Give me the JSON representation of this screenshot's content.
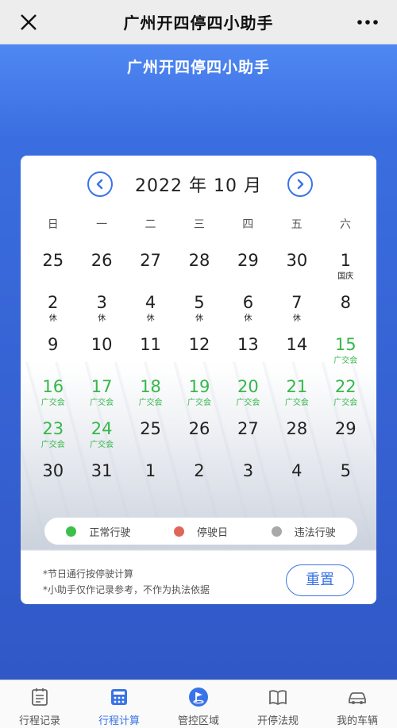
{
  "topbar": {
    "title": "广州开四停四小助手"
  },
  "banner": {
    "title": "广州开四停四小助手"
  },
  "calendar": {
    "month_title": "2022 年 10 月",
    "weekdays": [
      "日",
      "一",
      "二",
      "三",
      "四",
      "五",
      "六"
    ],
    "days": [
      {
        "n": "25",
        "note": ""
      },
      {
        "n": "26",
        "note": ""
      },
      {
        "n": "27",
        "note": ""
      },
      {
        "n": "28",
        "note": ""
      },
      {
        "n": "29",
        "note": ""
      },
      {
        "n": "30",
        "note": ""
      },
      {
        "n": "1",
        "note": "国庆"
      },
      {
        "n": "2",
        "note": "休"
      },
      {
        "n": "3",
        "note": "休"
      },
      {
        "n": "4",
        "note": "休"
      },
      {
        "n": "5",
        "note": "休"
      },
      {
        "n": "6",
        "note": "休"
      },
      {
        "n": "7",
        "note": "休"
      },
      {
        "n": "8",
        "note": ""
      },
      {
        "n": "9",
        "note": ""
      },
      {
        "n": "10",
        "note": ""
      },
      {
        "n": "11",
        "note": ""
      },
      {
        "n": "12",
        "note": ""
      },
      {
        "n": "13",
        "note": ""
      },
      {
        "n": "14",
        "note": ""
      },
      {
        "n": "15",
        "note": "广交会",
        "green": true
      },
      {
        "n": "16",
        "note": "广交会",
        "green": true
      },
      {
        "n": "17",
        "note": "广交会",
        "green": true
      },
      {
        "n": "18",
        "note": "广交会",
        "green": true
      },
      {
        "n": "19",
        "note": "广交会",
        "green": true
      },
      {
        "n": "20",
        "note": "广交会",
        "green": true
      },
      {
        "n": "21",
        "note": "广交会",
        "green": true
      },
      {
        "n": "22",
        "note": "广交会",
        "green": true
      },
      {
        "n": "23",
        "note": "广交会",
        "green": true
      },
      {
        "n": "24",
        "note": "广交会",
        "green": true
      },
      {
        "n": "25",
        "note": ""
      },
      {
        "n": "26",
        "note": ""
      },
      {
        "n": "27",
        "note": ""
      },
      {
        "n": "28",
        "note": ""
      },
      {
        "n": "29",
        "note": ""
      },
      {
        "n": "30",
        "note": ""
      },
      {
        "n": "31",
        "note": ""
      },
      {
        "n": "1",
        "note": ""
      },
      {
        "n": "2",
        "note": ""
      },
      {
        "n": "3",
        "note": ""
      },
      {
        "n": "4",
        "note": ""
      },
      {
        "n": "5",
        "note": ""
      }
    ]
  },
  "legend": [
    {
      "label": "正常行驶",
      "color": "#3cc04b"
    },
    {
      "label": "停驶日",
      "color": "#e0665a"
    },
    {
      "label": "违法行驶",
      "color": "#a8a8a8"
    }
  ],
  "footnotes": {
    "line1": "*节日通行按停驶计算",
    "line2": "*小助手仅作记录参考，不作为执法依据"
  },
  "reset_label": "重置",
  "tabs": [
    {
      "label": "行程记录",
      "icon": "calendar-list-icon"
    },
    {
      "label": "行程计算",
      "icon": "calculator-icon",
      "active": true
    },
    {
      "label": "管控区域",
      "icon": "map-flag-icon"
    },
    {
      "label": "开停法规",
      "icon": "book-icon"
    },
    {
      "label": "我的车辆",
      "icon": "car-icon"
    }
  ],
  "colors": {
    "accent": "#3a73e8",
    "green": "#35b84a"
  }
}
